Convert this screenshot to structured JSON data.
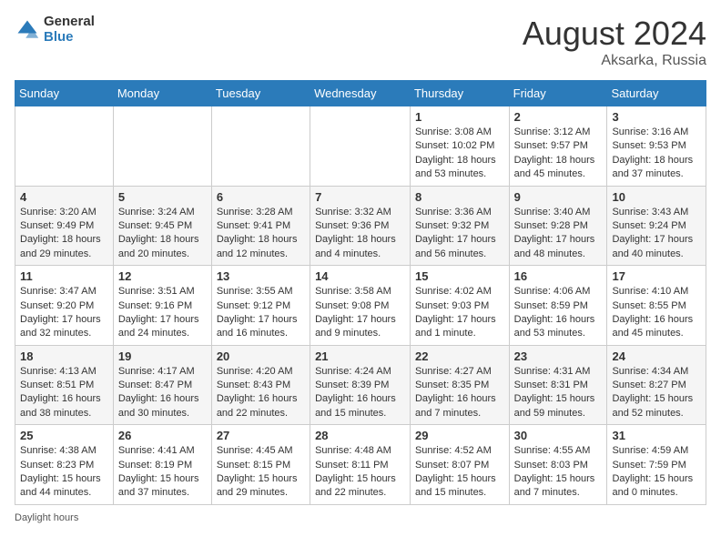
{
  "header": {
    "logo_general": "General",
    "logo_blue": "Blue",
    "month_title": "August 2024",
    "location": "Aksarka, Russia"
  },
  "days_of_week": [
    "Sunday",
    "Monday",
    "Tuesday",
    "Wednesday",
    "Thursday",
    "Friday",
    "Saturday"
  ],
  "weeks": [
    [
      {
        "day": "",
        "info": ""
      },
      {
        "day": "",
        "info": ""
      },
      {
        "day": "",
        "info": ""
      },
      {
        "day": "",
        "info": ""
      },
      {
        "day": "1",
        "info": "Sunrise: 3:08 AM\nSunset: 10:02 PM\nDaylight: 18 hours and 53 minutes."
      },
      {
        "day": "2",
        "info": "Sunrise: 3:12 AM\nSunset: 9:57 PM\nDaylight: 18 hours and 45 minutes."
      },
      {
        "day": "3",
        "info": "Sunrise: 3:16 AM\nSunset: 9:53 PM\nDaylight: 18 hours and 37 minutes."
      }
    ],
    [
      {
        "day": "4",
        "info": "Sunrise: 3:20 AM\nSunset: 9:49 PM\nDaylight: 18 hours and 29 minutes."
      },
      {
        "day": "5",
        "info": "Sunrise: 3:24 AM\nSunset: 9:45 PM\nDaylight: 18 hours and 20 minutes."
      },
      {
        "day": "6",
        "info": "Sunrise: 3:28 AM\nSunset: 9:41 PM\nDaylight: 18 hours and 12 minutes."
      },
      {
        "day": "7",
        "info": "Sunrise: 3:32 AM\nSunset: 9:36 PM\nDaylight: 18 hours and 4 minutes."
      },
      {
        "day": "8",
        "info": "Sunrise: 3:36 AM\nSunset: 9:32 PM\nDaylight: 17 hours and 56 minutes."
      },
      {
        "day": "9",
        "info": "Sunrise: 3:40 AM\nSunset: 9:28 PM\nDaylight: 17 hours and 48 minutes."
      },
      {
        "day": "10",
        "info": "Sunrise: 3:43 AM\nSunset: 9:24 PM\nDaylight: 17 hours and 40 minutes."
      }
    ],
    [
      {
        "day": "11",
        "info": "Sunrise: 3:47 AM\nSunset: 9:20 PM\nDaylight: 17 hours and 32 minutes."
      },
      {
        "day": "12",
        "info": "Sunrise: 3:51 AM\nSunset: 9:16 PM\nDaylight: 17 hours and 24 minutes."
      },
      {
        "day": "13",
        "info": "Sunrise: 3:55 AM\nSunset: 9:12 PM\nDaylight: 17 hours and 16 minutes."
      },
      {
        "day": "14",
        "info": "Sunrise: 3:58 AM\nSunset: 9:08 PM\nDaylight: 17 hours and 9 minutes."
      },
      {
        "day": "15",
        "info": "Sunrise: 4:02 AM\nSunset: 9:03 PM\nDaylight: 17 hours and 1 minute."
      },
      {
        "day": "16",
        "info": "Sunrise: 4:06 AM\nSunset: 8:59 PM\nDaylight: 16 hours and 53 minutes."
      },
      {
        "day": "17",
        "info": "Sunrise: 4:10 AM\nSunset: 8:55 PM\nDaylight: 16 hours and 45 minutes."
      }
    ],
    [
      {
        "day": "18",
        "info": "Sunrise: 4:13 AM\nSunset: 8:51 PM\nDaylight: 16 hours and 38 minutes."
      },
      {
        "day": "19",
        "info": "Sunrise: 4:17 AM\nSunset: 8:47 PM\nDaylight: 16 hours and 30 minutes."
      },
      {
        "day": "20",
        "info": "Sunrise: 4:20 AM\nSunset: 8:43 PM\nDaylight: 16 hours and 22 minutes."
      },
      {
        "day": "21",
        "info": "Sunrise: 4:24 AM\nSunset: 8:39 PM\nDaylight: 16 hours and 15 minutes."
      },
      {
        "day": "22",
        "info": "Sunrise: 4:27 AM\nSunset: 8:35 PM\nDaylight: 16 hours and 7 minutes."
      },
      {
        "day": "23",
        "info": "Sunrise: 4:31 AM\nSunset: 8:31 PM\nDaylight: 15 hours and 59 minutes."
      },
      {
        "day": "24",
        "info": "Sunrise: 4:34 AM\nSunset: 8:27 PM\nDaylight: 15 hours and 52 minutes."
      }
    ],
    [
      {
        "day": "25",
        "info": "Sunrise: 4:38 AM\nSunset: 8:23 PM\nDaylight: 15 hours and 44 minutes."
      },
      {
        "day": "26",
        "info": "Sunrise: 4:41 AM\nSunset: 8:19 PM\nDaylight: 15 hours and 37 minutes."
      },
      {
        "day": "27",
        "info": "Sunrise: 4:45 AM\nSunset: 8:15 PM\nDaylight: 15 hours and 29 minutes."
      },
      {
        "day": "28",
        "info": "Sunrise: 4:48 AM\nSunset: 8:11 PM\nDaylight: 15 hours and 22 minutes."
      },
      {
        "day": "29",
        "info": "Sunrise: 4:52 AM\nSunset: 8:07 PM\nDaylight: 15 hours and 15 minutes."
      },
      {
        "day": "30",
        "info": "Sunrise: 4:55 AM\nSunset: 8:03 PM\nDaylight: 15 hours and 7 minutes."
      },
      {
        "day": "31",
        "info": "Sunrise: 4:59 AM\nSunset: 7:59 PM\nDaylight: 15 hours and 0 minutes."
      }
    ]
  ],
  "footer_note": "Daylight hours"
}
